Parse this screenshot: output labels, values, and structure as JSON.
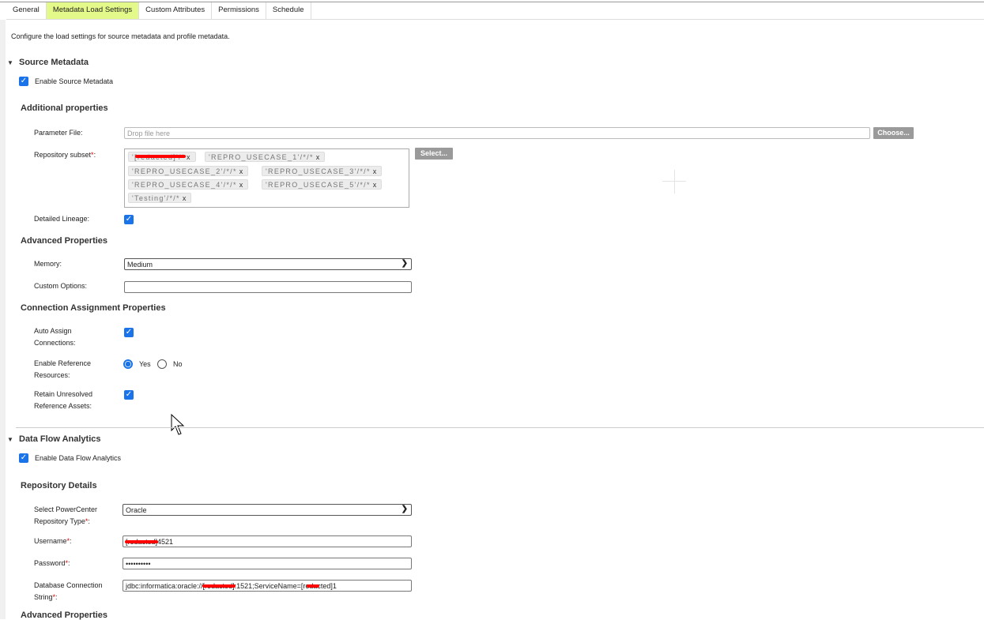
{
  "tabs": [
    "General",
    "Metadata Load Settings",
    "Custom Attributes",
    "Permissions",
    "Schedule"
  ],
  "active_tab": "Metadata Load Settings",
  "description": "Configure the load settings for source metadata and profile metadata.",
  "source_metadata": {
    "title": "Source Metadata",
    "enable_label": "Enable Source Metadata",
    "enabled": true,
    "additional_title": "Additional properties",
    "parameter_file_label": "Parameter File:",
    "parameter_file_placeholder": "Drop file here",
    "choose_label": "Choose...",
    "repository_subset_label": "Repository subset",
    "repository_subset": [
      "'[redacted]'/*/*",
      "'REPRO_USECASE_1'/*/*",
      "'REPRO_USECASE_2'/*/*",
      "'REPRO_USECASE_3'/*/*",
      "'REPRO_USECASE_4'/*/*",
      "'REPRO_USECASE_5'/*/*",
      "'Testing'/*/*"
    ],
    "chip_remove": "x",
    "select_label": "Select...",
    "detailed_lineage_label": "Detailed Lineage:",
    "detailed_lineage": true,
    "advanced_title": "Advanced Properties",
    "memory_label": "Memory:",
    "memory_value": "Medium",
    "custom_options_label": "Custom Options:",
    "custom_options_value": "",
    "connection_title": "Connection Assignment Properties",
    "auto_assign_label": "Auto Assign Connections:",
    "auto_assign": true,
    "enable_ref_label": "Enable Reference Resources:",
    "enable_ref": "Yes",
    "yes": "Yes",
    "no": "No",
    "retain_label": "Retain Unresolved Reference Assets:",
    "retain": true
  },
  "data_flow": {
    "title": "Data Flow Analytics",
    "enable_label": "Enable Data Flow Analytics",
    "enabled": true,
    "repo_title": "Repository Details",
    "repo_type_label": "Select PowerCenter Repository Type",
    "repo_type_value": "Oracle",
    "username_label": "Username",
    "username_value": "[redacted]4521",
    "password_label": "Password",
    "password_value": "••••••••••",
    "conn_label": "Database Connection String",
    "conn_value": "jdbc:informatica:oracle://[redacted]:1521;ServiceName=[redacted]1",
    "advanced_title": "Advanced Properties"
  },
  "colors": {
    "active_tab": "#e3fa8a",
    "checkbox": "#1a73e8",
    "required": "#dd0000"
  }
}
